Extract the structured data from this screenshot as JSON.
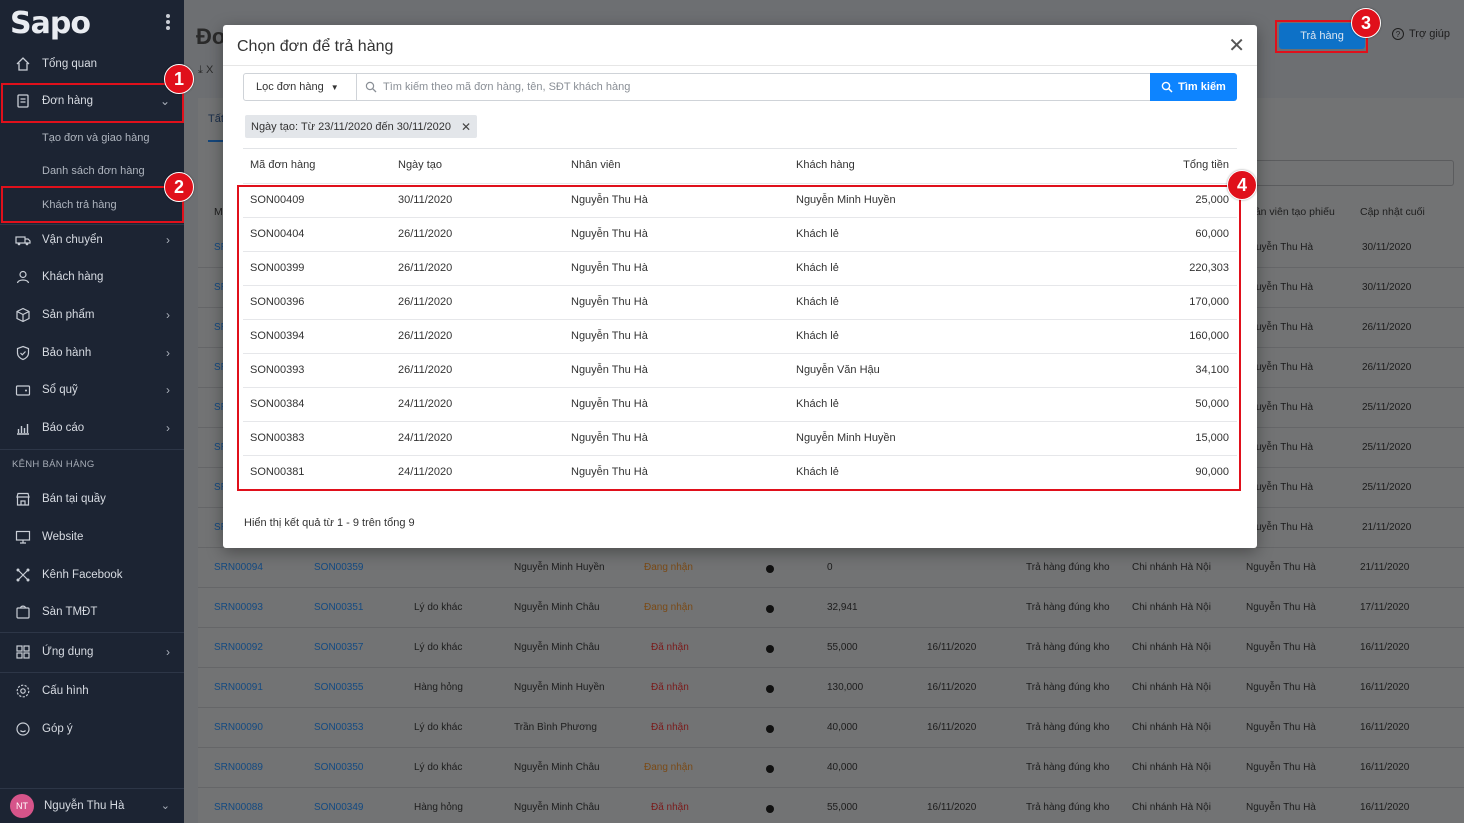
{
  "sidebar": {
    "logo": "Sapo",
    "items": [
      {
        "label": "Tổng quan",
        "icon": "home-icon"
      },
      {
        "label": "Đơn hàng",
        "icon": "order-icon"
      },
      {
        "label": "Vận chuyển",
        "icon": "truck-icon"
      },
      {
        "label": "Khách hàng",
        "icon": "user-icon"
      },
      {
        "label": "Sản phẩm",
        "icon": "box-icon"
      },
      {
        "label": "Bảo hành",
        "icon": "shield-icon"
      },
      {
        "label": "Sổ quỹ",
        "icon": "wallet-icon"
      },
      {
        "label": "Báo cáo",
        "icon": "chart-icon"
      }
    ],
    "sub_items": [
      "Tạo đơn và giao hàng",
      "Danh sách đơn hàng",
      "Khách trả hàng"
    ],
    "section_label": "KÊNH BÁN HÀNG",
    "channels": [
      {
        "label": "Bán tại quầy",
        "icon": "store-icon"
      },
      {
        "label": "Website",
        "icon": "monitor-icon"
      },
      {
        "label": "Kênh Facebook",
        "icon": "share-icon"
      },
      {
        "label": "Sàn TMĐT",
        "icon": "marketplace-icon"
      }
    ],
    "bottom": [
      {
        "label": "Ứng dụng",
        "icon": "apps-icon"
      },
      {
        "label": "Cấu hình",
        "icon": "settings-icon"
      },
      {
        "label": "Góp ý",
        "icon": "feedback-icon"
      }
    ],
    "user": {
      "initials": "NT",
      "name": "Nguyễn Thu Hà"
    }
  },
  "header": {
    "title": "Đơ",
    "export_label": "X",
    "return_button": "Trả hàng",
    "help": "Trợ giúp"
  },
  "annotations": [
    "1",
    "2",
    "3",
    "4"
  ],
  "background": {
    "tab": "Tất",
    "headers": [
      "M",
      "hân viên tạo phiếu",
      "Cập nhật cuối"
    ],
    "side_rows": [
      {
        "staff": "uyễn Thu Hà",
        "updated": "30/11/2020",
        "prefix": "SR"
      },
      {
        "staff": "uyễn Thu Hà",
        "updated": "30/11/2020",
        "prefix": "SR"
      },
      {
        "staff": "uyễn Thu Hà",
        "updated": "26/11/2020",
        "prefix": "SR"
      },
      {
        "staff": "uyễn Thu Hà",
        "updated": "26/11/2020",
        "prefix": "SR"
      },
      {
        "staff": "uyễn Thu Hà",
        "updated": "25/11/2020",
        "prefix": "SR"
      },
      {
        "staff": "uyễn Thu Hà",
        "updated": "25/11/2020",
        "prefix": "SR"
      },
      {
        "staff": "uyễn Thu Hà",
        "updated": "25/11/2020",
        "prefix": "SR"
      },
      {
        "staff": "uyễn Thu Hà",
        "updated": "21/11/2020",
        "prefix": "SR"
      }
    ],
    "rows": [
      {
        "code": "SRN00094",
        "order": "SON00359",
        "reason": "",
        "customer": "Nguyễn Minh Huyền",
        "status": "Đang nhận",
        "status_type": "pending",
        "amount": "0",
        "date": "",
        "type": "Trả hàng đúng kho",
        "branch": "Chi nhánh Hà Nội",
        "staff": "Nguyễn Thu Hà",
        "updated": "21/11/2020"
      },
      {
        "code": "SRN00093",
        "order": "SON00351",
        "reason": "Lý do khác",
        "customer": "Nguyễn Minh Châu",
        "status": "Đang nhận",
        "status_type": "pending",
        "amount": "32,941",
        "date": "",
        "type": "Trả hàng đúng kho",
        "branch": "Chi nhánh Hà Nội",
        "staff": "Nguyễn Thu Hà",
        "updated": "17/11/2020"
      },
      {
        "code": "SRN00092",
        "order": "SON00357",
        "reason": "Lý do khác",
        "customer": "Nguyễn Minh Châu",
        "status": "Đã nhận",
        "status_type": "done",
        "amount": "55,000",
        "date": "16/11/2020",
        "type": "Trả hàng đúng kho",
        "branch": "Chi nhánh Hà Nội",
        "staff": "Nguyễn Thu Hà",
        "updated": "16/11/2020"
      },
      {
        "code": "SRN00091",
        "order": "SON00355",
        "reason": "Hàng hỏng",
        "customer": "Nguyễn Minh Huyền",
        "status": "Đã nhận",
        "status_type": "done",
        "amount": "130,000",
        "date": "16/11/2020",
        "type": "Trả hàng đúng kho",
        "branch": "Chi nhánh Hà Nội",
        "staff": "Nguyễn Thu Hà",
        "updated": "16/11/2020"
      },
      {
        "code": "SRN00090",
        "order": "SON00353",
        "reason": "Lý do khác",
        "customer": "Trần Bình Phương",
        "status": "Đã nhận",
        "status_type": "done",
        "amount": "40,000",
        "date": "16/11/2020",
        "type": "Trả hàng đúng kho",
        "branch": "Chi nhánh Hà Nội",
        "staff": "Nguyễn Thu Hà",
        "updated": "16/11/2020"
      },
      {
        "code": "SRN00089",
        "order": "SON00350",
        "reason": "Lý do khác",
        "customer": "Nguyễn Minh Châu",
        "status": "Đang nhận",
        "status_type": "pending",
        "amount": "40,000",
        "date": "",
        "type": "Trả hàng đúng kho",
        "branch": "Chi nhánh Hà Nội",
        "staff": "Nguyễn Thu Hà",
        "updated": "16/11/2020"
      },
      {
        "code": "SRN00088",
        "order": "SON00349",
        "reason": "Hàng hỏng",
        "customer": "Nguyễn Minh Châu",
        "status": "Đã nhận",
        "status_type": "done",
        "amount": "55,000",
        "date": "16/11/2020",
        "type": "Trả hàng đúng kho",
        "branch": "Chi nhánh Hà Nội",
        "staff": "Nguyễn Thu Hà",
        "updated": "16/11/2020"
      }
    ]
  },
  "modal": {
    "title": "Chọn đơn để trả hàng",
    "filter_label": "Lọc đơn hàng",
    "search_placeholder": "Tìm kiếm theo mã đơn hàng, tên, SĐT khách hàng",
    "search_button": "Tìm kiếm",
    "chip": "Ngày tạo: Từ 23/11/2020 đến 30/11/2020",
    "columns": [
      "Mã đơn hàng",
      "Ngày tạo",
      "Nhân viên",
      "Khách hàng",
      "Tổng tiền"
    ],
    "rows": [
      {
        "code": "SON00409",
        "date": "30/11/2020",
        "staff": "Nguyễn Thu Hà",
        "customer": "Nguyễn Minh Huyền",
        "total": "25,000"
      },
      {
        "code": "SON00404",
        "date": "26/11/2020",
        "staff": "Nguyễn Thu Hà",
        "customer": "Khách lẻ",
        "total": "60,000"
      },
      {
        "code": "SON00399",
        "date": "26/11/2020",
        "staff": "Nguyễn Thu Hà",
        "customer": "Khách lẻ",
        "total": "220,303"
      },
      {
        "code": "SON00396",
        "date": "26/11/2020",
        "staff": "Nguyễn Thu Hà",
        "customer": "Khách lẻ",
        "total": "170,000"
      },
      {
        "code": "SON00394",
        "date": "26/11/2020",
        "staff": "Nguyễn Thu Hà",
        "customer": "Khách lẻ",
        "total": "160,000"
      },
      {
        "code": "SON00393",
        "date": "26/11/2020",
        "staff": "Nguyễn Thu Hà",
        "customer": "Nguyễn Văn Hậu",
        "total": "34,100"
      },
      {
        "code": "SON00384",
        "date": "24/11/2020",
        "staff": "Nguyễn Thu Hà",
        "customer": "Khách lẻ",
        "total": "50,000"
      },
      {
        "code": "SON00383",
        "date": "24/11/2020",
        "staff": "Nguyễn Thu Hà",
        "customer": "Nguyễn Minh Huyền",
        "total": "15,000"
      },
      {
        "code": "SON00381",
        "date": "24/11/2020",
        "staff": "Nguyễn Thu Hà",
        "customer": "Khách lẻ",
        "total": "90,000"
      }
    ],
    "summary": "Hiển thị kết quả từ 1 - 9 trên tổng 9"
  },
  "colors": {
    "accent": "#0d84ff",
    "sidebar": "#1c2433",
    "highlight": "#e0101b"
  }
}
